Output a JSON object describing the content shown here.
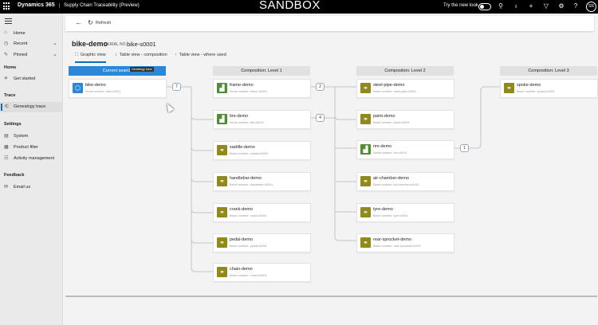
{
  "topbar": {
    "brand": "Dynamics 365",
    "app_name": "Supply Chain Traceability (Preview)",
    "environment": "SANDBOX",
    "try_new_look": "Try the new look",
    "avatar_initials": "SR"
  },
  "sidebar": {
    "items": [
      {
        "label": "Home",
        "icon": "home-icon",
        "glyph": "⌂"
      },
      {
        "label": "Recent",
        "icon": "clock-icon",
        "glyph": "◷",
        "chevron": "⌄"
      },
      {
        "label": "Pinned",
        "icon": "pin-icon",
        "glyph": "✎",
        "chevron": "⌄"
      }
    ],
    "sections": [
      {
        "title": "Home",
        "items": [
          {
            "label": "Get started",
            "icon": "rocket-icon",
            "glyph": "✈"
          }
        ]
      },
      {
        "title": "Trace",
        "items": [
          {
            "label": "Genealogy trace",
            "icon": "tree-icon",
            "glyph": "⋲"
          }
        ]
      },
      {
        "title": "Settings",
        "items": [
          {
            "label": "System",
            "icon": "system-icon",
            "glyph": "▤"
          },
          {
            "label": "Product filter",
            "icon": "filter-icon",
            "glyph": "▦"
          },
          {
            "label": "Activity management",
            "icon": "activity-icon",
            "glyph": "☷"
          }
        ]
      },
      {
        "title": "Feedback",
        "items": [
          {
            "label": "Email us",
            "icon": "mail-icon",
            "glyph": "✉"
          }
        ]
      }
    ]
  },
  "commandbar": {
    "refresh_label": "Refresh"
  },
  "header": {
    "title": "bike-demo",
    "serial_label": "SERIAL NO.",
    "serial_value": "bike-s0001"
  },
  "tabs": [
    {
      "label": "Graphic view",
      "glyph": "⛶"
    },
    {
      "label": "Table view - composition",
      "glyph": "↕"
    },
    {
      "label": "Table view - where used",
      "glyph": "↑"
    }
  ],
  "columns": [
    {
      "label": "Current search"
    },
    {
      "label": "Composition: Level 1"
    },
    {
      "label": "Composition: Level 2"
    },
    {
      "label": "Composition: Level 3"
    }
  ],
  "tooltip": "Genealogy trace",
  "nodes": {
    "current": {
      "name": "bike-demo",
      "sub": "Serial number: bike-s0001",
      "color": "#2b88d8",
      "glyph": "⬡"
    },
    "level1": [
      {
        "name": "frame-demo",
        "sub": "Serial number: frame-s0001",
        "color": "#4f8f2f",
        "glyph": "▟"
      },
      {
        "name": "tire-demo",
        "sub": "Serial number: tire-s0001",
        "color": "#4f8f2f",
        "glyph": "▟"
      },
      {
        "name": "saddle-demo",
        "sub": "Batch number: saddle-b0001",
        "color": "#8f8a1a",
        "glyph": "⚭"
      },
      {
        "name": "handlebar-demo",
        "sub": "Batch number: handlebar-b0001",
        "color": "#8f8a1a",
        "glyph": "⚭"
      },
      {
        "name": "crank-demo",
        "sub": "Batch number: crank-b0001",
        "color": "#8f8a1a",
        "glyph": "⚭"
      },
      {
        "name": "pedal-demo",
        "sub": "Batch number: pedal-b0001",
        "color": "#8f8a1a",
        "glyph": "⚭"
      },
      {
        "name": "chain-demo",
        "sub": "Batch number: chain-b0001",
        "color": "#8f8a1a",
        "glyph": "⚭"
      }
    ],
    "level2": [
      {
        "name": "steel-pipe-demo",
        "sub": "Batch number: steel-pipe-b0001",
        "color": "#8f8a1a",
        "glyph": "⚭"
      },
      {
        "name": "paint-demo",
        "sub": "Batch number: paint-b0001",
        "color": "#8f8a1a",
        "glyph": "⚭"
      },
      {
        "name": "rim-demo",
        "sub": "Serial number: rim-s0001",
        "color": "#4f8f2f",
        "glyph": "▟"
      },
      {
        "name": "air-chamber-demo",
        "sub": "Batch number: air-chamber-b0001",
        "color": "#8f8a1a",
        "glyph": "⚭"
      },
      {
        "name": "tyre-demo",
        "sub": "Batch number: tyre-b0001",
        "color": "#8f8a1a",
        "glyph": "⚭"
      },
      {
        "name": "rear-sprocket-demo",
        "sub": "Batch number: rear-sprocket-b0001",
        "color": "#8f8a1a",
        "glyph": "⚭"
      }
    ],
    "level3": [
      {
        "name": "spoke-demo",
        "sub": "Batch number: spoke-b0001",
        "color": "#8f8a1a",
        "glyph": "⚭"
      }
    ]
  },
  "badges": {
    "bike": "7",
    "frame": "2",
    "tire": "4",
    "rim": "1"
  }
}
